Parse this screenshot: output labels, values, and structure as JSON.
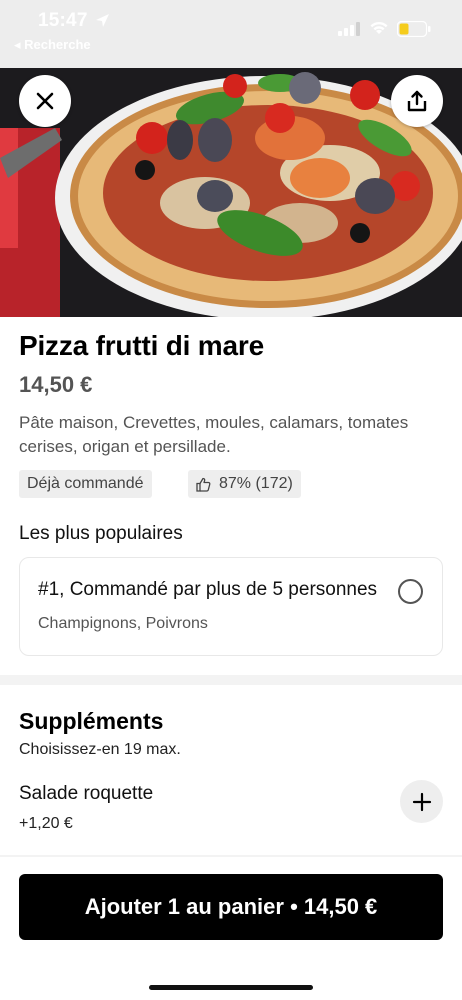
{
  "status_bar": {
    "time": "15:47",
    "back_label": "◂ Recherche"
  },
  "hero": {
    "close_icon": "close-icon",
    "share_icon": "share-icon"
  },
  "product": {
    "name": "Pizza frutti di mare",
    "price": "14,50 €",
    "description": "Pâte maison, Crevettes, moules, calamars, tomates cerises, origan et persillade.",
    "tags": {
      "ordered": "Déjà commandé",
      "rating": "87% (172)"
    }
  },
  "popular": {
    "section_title": "Les plus populaires",
    "option_title": "#1, Commandé par plus de 5 personnes",
    "option_details": "Champignons, Poivrons"
  },
  "supplements": {
    "title": "Suppléments",
    "subtitle": "Choisissez-en 19 max.",
    "items": [
      {
        "name": "Salade roquette",
        "price": "+1,20 €"
      }
    ]
  },
  "cart_button": {
    "label": "Ajouter 1 au panier • 14,50 €"
  },
  "colors": {
    "primary": "#000000",
    "secondary_text": "#545454",
    "tag_bg": "#eeeeee"
  }
}
